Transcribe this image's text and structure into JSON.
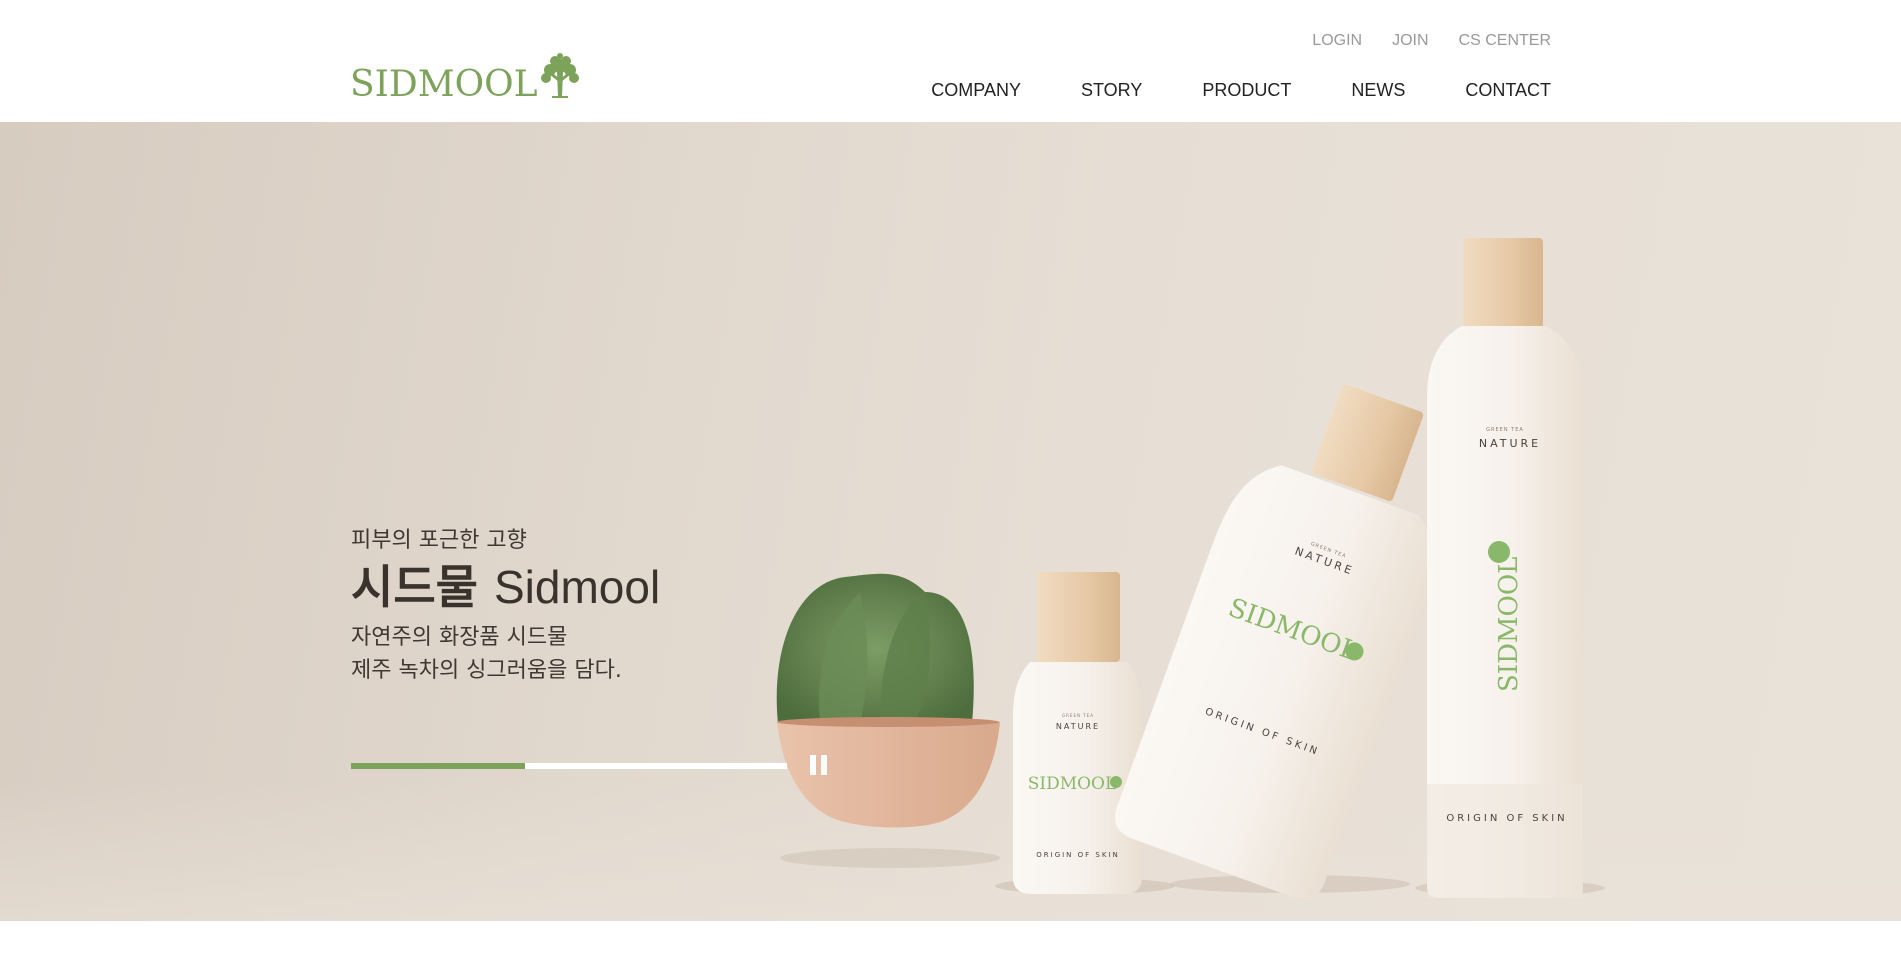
{
  "brand": {
    "logo_text": "SIDMOOL"
  },
  "utility_nav": [
    {
      "label": "LOGIN"
    },
    {
      "label": "JOIN"
    },
    {
      "label": "CS CENTER"
    }
  ],
  "main_nav": [
    {
      "label": "COMPANY"
    },
    {
      "label": "STORY"
    },
    {
      "label": "PRODUCT"
    },
    {
      "label": "NEWS"
    },
    {
      "label": "CONTACT"
    }
  ],
  "hero": {
    "subtitle": "피부의 포근한 고향",
    "title_bold": "시드물",
    "title_light": "Sidmool",
    "desc_line1": "자연주의 화장품 시드물",
    "desc_line2": "제주 녹차의 싱그러움을 담다.",
    "slider_progress": 0.4,
    "pause_icon": "pause-icon"
  },
  "product_labels": {
    "small_caps": "GREEN TEA",
    "nature": "NATURE",
    "brand": "SIDMOOL",
    "origin": "ORIGIN OF SKIN"
  },
  "colors": {
    "accent_green": "#7da35a",
    "hero_beige": "#e3dad0",
    "text_dark": "#3a322c"
  }
}
